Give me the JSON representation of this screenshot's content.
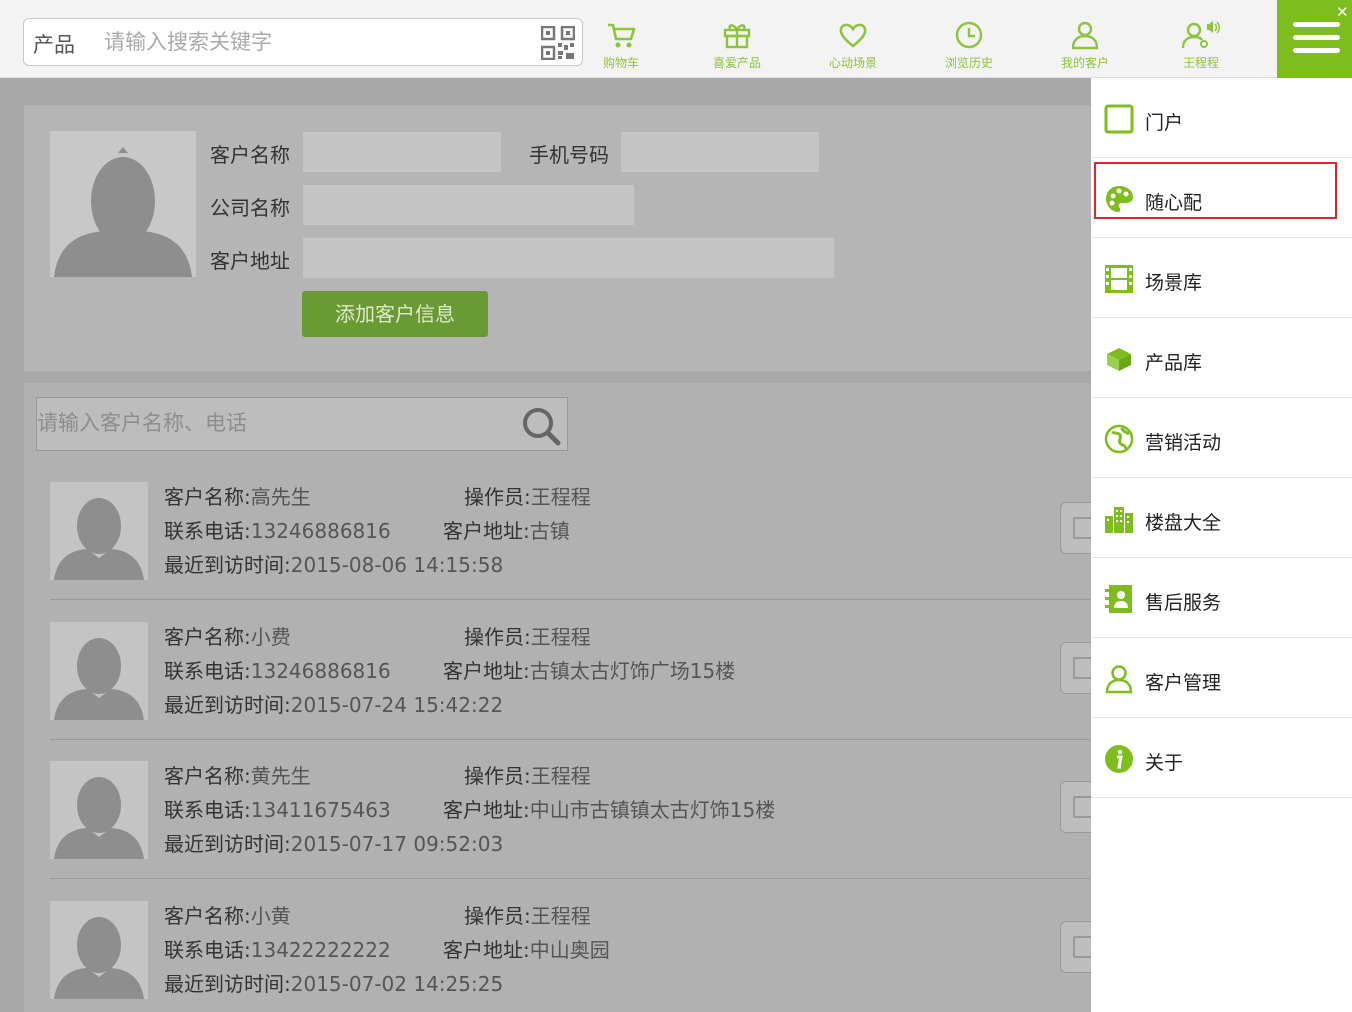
{
  "search": {
    "category": "产品",
    "placeholder": "请输入搜索关键字"
  },
  "nav": [
    {
      "label": "购物车",
      "icon": "cart-icon"
    },
    {
      "label": "喜爱产品",
      "icon": "gift-icon"
    },
    {
      "label": "心动场景",
      "icon": "heart-icon"
    },
    {
      "label": "浏览历史",
      "icon": "clock-icon"
    },
    {
      "label": "我的客户",
      "icon": "user-icon"
    },
    {
      "label": "王程程",
      "icon": "user-settings-icon"
    }
  ],
  "form": {
    "name_label": "客户名称",
    "phone_label": "手机号码",
    "company_label": "公司名称",
    "address_label": "客户地址",
    "add_button": "添加客户信息"
  },
  "list": {
    "search_placeholder": "请输入客户名称、电话",
    "labels": {
      "name": "客户名称:",
      "operator": "操作员:",
      "phone": "联系电话:",
      "address": "客户地址:",
      "last_visit": "最近到访时间:"
    },
    "customers": [
      {
        "name": "高先生",
        "operator": "王程程",
        "phone": "13246886816",
        "address": "古镇",
        "last_visit": "2015-08-06 14:15:58"
      },
      {
        "name": "小费",
        "operator": "王程程",
        "phone": "13246886816",
        "address": "古镇太古灯饰广场15楼",
        "last_visit": "2015-07-24 15:42:22"
      },
      {
        "name": "黄先生",
        "operator": "王程程",
        "phone": "13411675463",
        "address": "中山市古镇镇太古灯饰15楼",
        "last_visit": "2015-07-17 09:52:03"
      },
      {
        "name": "小黄",
        "operator": "王程程",
        "phone": "13422222222",
        "address": "中山奥园",
        "last_visit": "2015-07-02 14:25:25"
      }
    ]
  },
  "drawer": {
    "items": [
      {
        "label": "门户",
        "icon": "portal-icon"
      },
      {
        "label": "随心配",
        "icon": "palette-icon"
      },
      {
        "label": "场景库",
        "icon": "film-icon"
      },
      {
        "label": "产品库",
        "icon": "box-icon"
      },
      {
        "label": "营销活动",
        "icon": "globe-icon"
      },
      {
        "label": "楼盘大全",
        "icon": "building-icon"
      },
      {
        "label": "售后服务",
        "icon": "contact-book-icon"
      },
      {
        "label": "客户管理",
        "icon": "user-icon"
      },
      {
        "label": "关于",
        "icon": "info-icon"
      }
    ]
  },
  "colors": {
    "accent": "#7dbd1e",
    "highlight": "#d9272e"
  }
}
